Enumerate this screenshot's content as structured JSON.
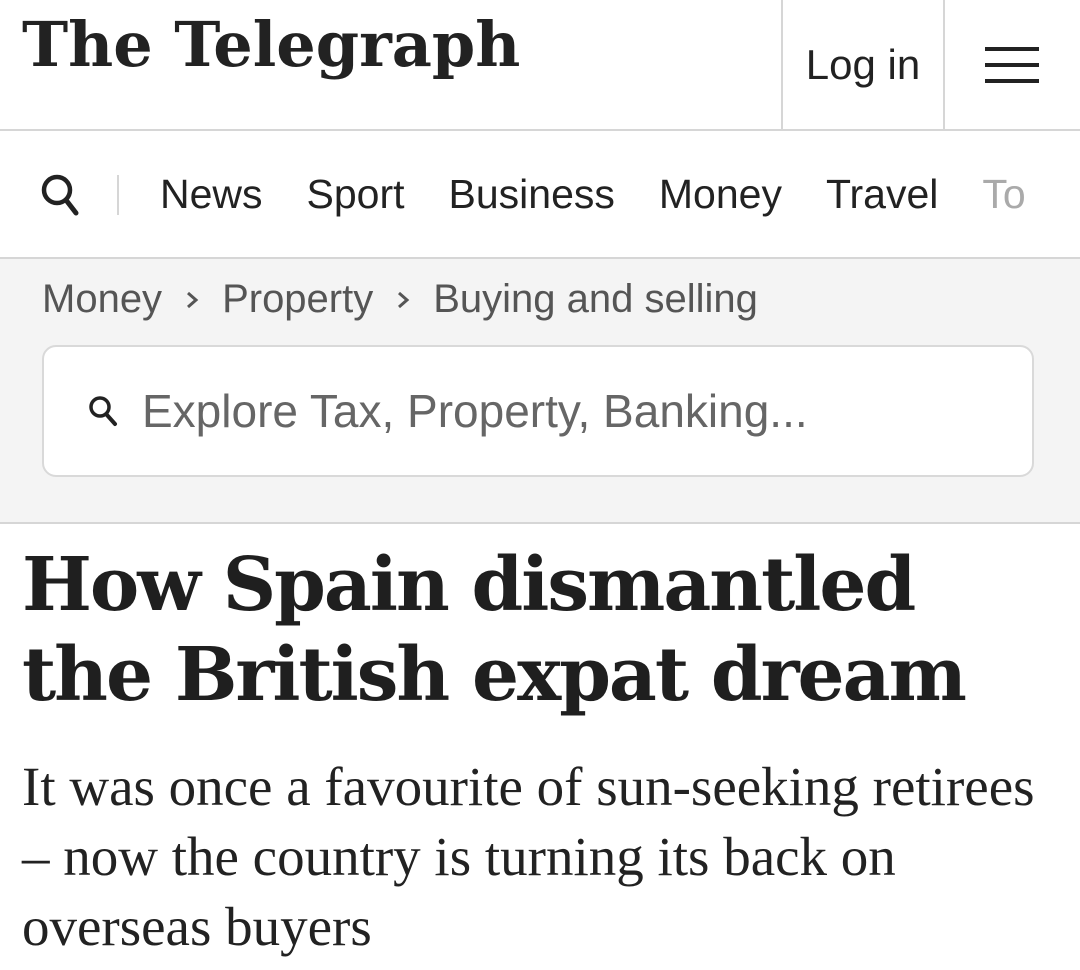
{
  "header": {
    "logo_text": "The Telegraph",
    "login_label": "Log in",
    "menu_icon": "hamburger-menu-icon"
  },
  "nav": {
    "search_icon": "search-icon",
    "items": [
      {
        "label": "News"
      },
      {
        "label": "Sport"
      },
      {
        "label": "Business"
      },
      {
        "label": "Money"
      },
      {
        "label": "Travel"
      },
      {
        "label": "To"
      }
    ]
  },
  "breadcrumb": {
    "items": [
      "Money",
      "Property",
      "Buying and selling"
    ]
  },
  "search": {
    "placeholder": "Explore Tax, Property, Banking..."
  },
  "article": {
    "headline": "How Spain dismantled the British expat dream",
    "standfirst": "It was once a favourite of sun-seeking retirees – now the country is turning its back on overseas buyers"
  }
}
